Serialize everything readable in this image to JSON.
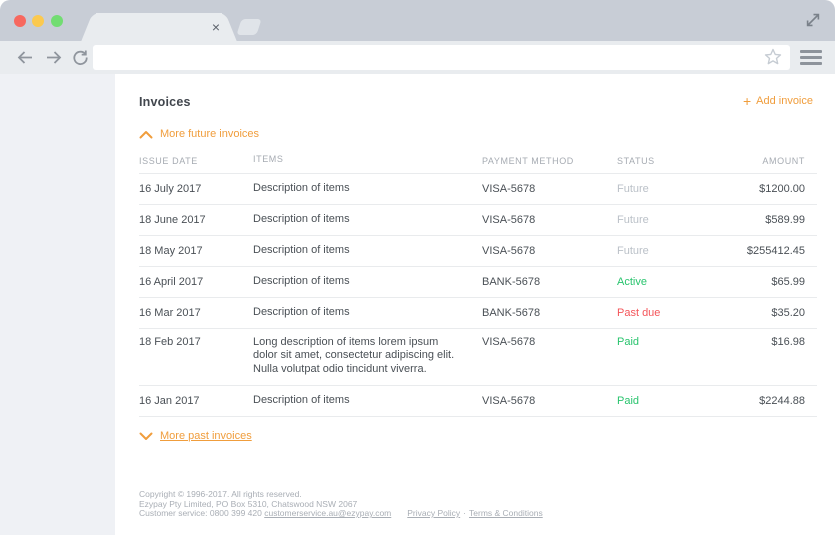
{
  "browser": {
    "tab_close_glyph": "×",
    "icons": {
      "back": "left-arrow",
      "forward": "right-arrow",
      "refresh": "reload-circle-arrow",
      "bookmark": "star-outline",
      "menu": "hamburger",
      "expand": "diagonal-resize-arrows"
    }
  },
  "page": {
    "title": "Invoices",
    "add_invoice": {
      "plus_glyph": "+",
      "label": "Add invoice"
    },
    "more_future_label": "More future invoices",
    "more_past_label": "More past invoices"
  },
  "table": {
    "headers": [
      "ISSUE DATE",
      "ITEMS",
      "PAYMENT METHOD",
      "STATUS",
      "AMOUNT"
    ],
    "rows": [
      {
        "issue_date": "16 July 2017",
        "items": "Description of items",
        "payment_method": "VISA-5678",
        "status": "Future",
        "status_type": "future",
        "amount": "$1200.00"
      },
      {
        "issue_date": "18 June 2017",
        "items": "Description of items",
        "payment_method": "VISA-5678",
        "status": "Future",
        "status_type": "future",
        "amount": "$589.99"
      },
      {
        "issue_date": "18 May 2017",
        "items": "Description of items",
        "payment_method": "VISA-5678",
        "status": "Future",
        "status_type": "future",
        "amount": "$255412.45"
      },
      {
        "issue_date": "16 April 2017",
        "items": "Description of items",
        "payment_method": "BANK-5678",
        "status": "Active",
        "status_type": "active",
        "amount": "$65.99"
      },
      {
        "issue_date": "16 Mar 2017",
        "items": "Description of items",
        "payment_method": "BANK-5678",
        "status": "Past due",
        "status_type": "past-due",
        "amount": "$35.20"
      },
      {
        "issue_date": "18 Feb 2017",
        "items": "Long description of items lorem ipsum dolor sit amet, consectetur adipiscing elit. Nulla volutpat odio tincidunt viverra.",
        "payment_method": "VISA-5678",
        "status": "Paid",
        "status_type": "paid",
        "amount": "$16.98"
      },
      {
        "issue_date": "16 Jan 2017",
        "items": "Description of items",
        "payment_method": "VISA-5678",
        "status": "Paid",
        "status_type": "paid",
        "amount": "$2244.88"
      }
    ]
  },
  "footer": {
    "line1": "Copyright © 1996-2017. All rights reserved.",
    "line2": "Ezypay Pty Limited, PO Box 5310, Chatswood NSW 2067",
    "line3_prefix": "Customer service: 0800 399 420 ",
    "email_link": "customerservice.au@ezypay.com",
    "privacy_link": "Privacy Policy",
    "separator": "·",
    "terms_link": "Terms & Conditions"
  },
  "colors": {
    "accent_orange": "#f09d3c",
    "status_green": "#29c46e",
    "status_red": "#f4555a",
    "status_muted": "#bbc1c8",
    "titlebar": "#c8cdd6",
    "toolbar": "#e9ecef",
    "sidebar": "#eff1f5"
  }
}
